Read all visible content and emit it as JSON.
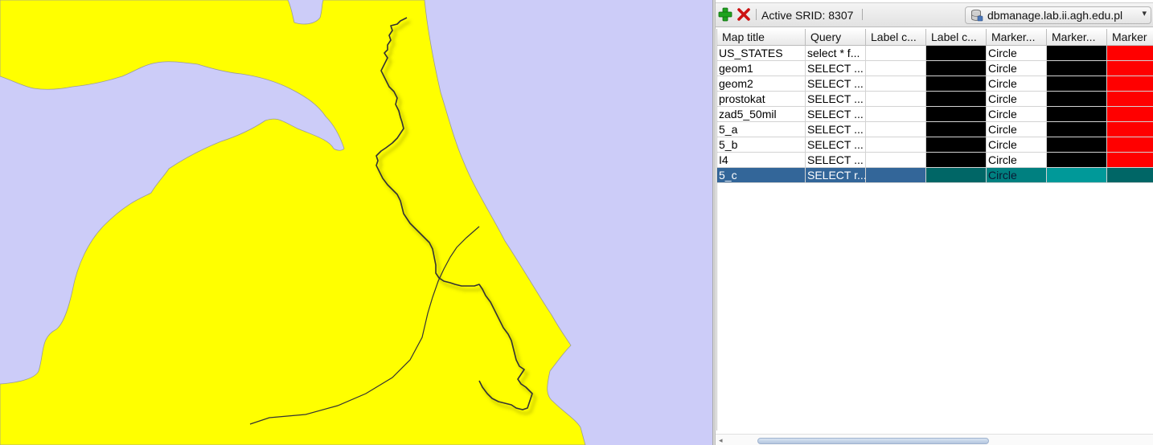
{
  "toolbar": {
    "active_srid_label": "Active SRID: 8307",
    "add_icon": "add-layer-icon",
    "remove_icon": "remove-layer-icon",
    "db_icon": "database-icon",
    "connection": "dbmanage.lab.ii.agh.edu.pl"
  },
  "table": {
    "columns": [
      "Map title",
      "Query",
      "Label c...",
      "Label c...",
      "Marker...",
      "Marker...",
      "Marker"
    ],
    "rows": [
      {
        "title": "US_STATES",
        "query": "select * f...",
        "label_color": "#000000",
        "marker_type": "Circle",
        "marker_color": "#000000",
        "marker_fill": "#ff0000"
      },
      {
        "title": "geom1",
        "query": "SELECT ...",
        "label_color": "#000000",
        "marker_type": "Circle",
        "marker_color": "#000000",
        "marker_fill": "#ff0000"
      },
      {
        "title": "geom2",
        "query": "SELECT ...",
        "label_color": "#000000",
        "marker_type": "Circle",
        "marker_color": "#000000",
        "marker_fill": "#ff0000"
      },
      {
        "title": "prostokat",
        "query": "SELECT  ...",
        "label_color": "#000000",
        "marker_type": "Circle",
        "marker_color": "#000000",
        "marker_fill": "#ff0000"
      },
      {
        "title": "zad5_50mil",
        "query": "SELECT ...",
        "label_color": "#000000",
        "marker_type": "Circle",
        "marker_color": "#000000",
        "marker_fill": "#ff0000"
      },
      {
        "title": "5_a",
        "query": "SELECT ...",
        "label_color": "#000000",
        "marker_type": "Circle",
        "marker_color": "#000000",
        "marker_fill": "#ff0000"
      },
      {
        "title": "5_b",
        "query": "SELECT ...",
        "label_color": "#000000",
        "marker_type": "Circle",
        "marker_color": "#000000",
        "marker_fill": "#ff0000"
      },
      {
        "title": "I4",
        "query": "SELECT ...",
        "label_color": "#000000",
        "marker_type": "Circle",
        "marker_color": "#000000",
        "marker_fill": "#ff0000"
      },
      {
        "title": "5_c",
        "query": "SELECT r...",
        "label_color": "#006666",
        "marker_type": "Circle",
        "marker_color": "#009999",
        "marker_fill": "#006666",
        "selected": true
      }
    ]
  },
  "map": {
    "land_color": "#ffff00",
    "water_color": "#ccccf8",
    "line_color": "#333333"
  },
  "colors": {
    "selection": "#336699"
  }
}
